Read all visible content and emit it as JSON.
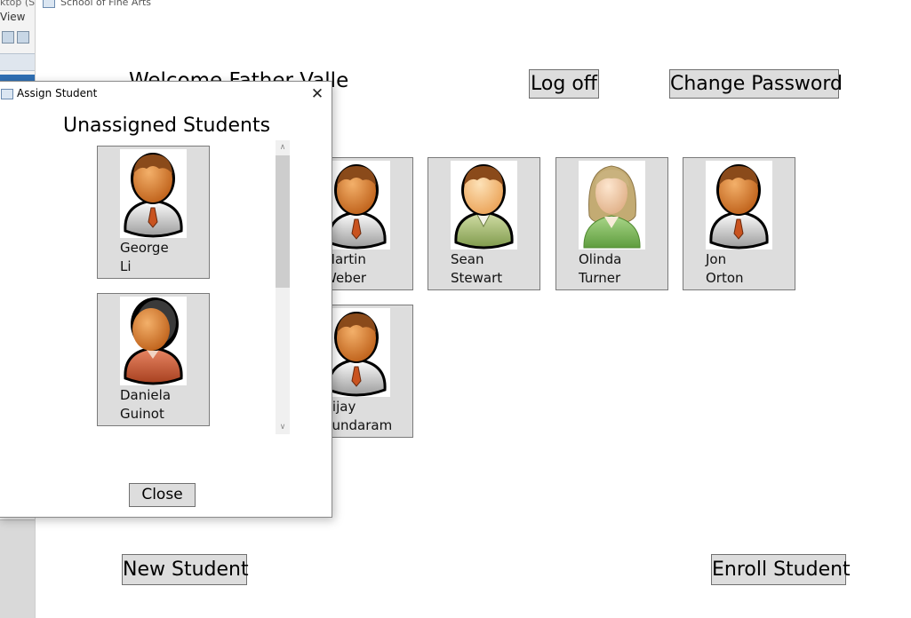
{
  "background_ide": {
    "title": "ktop (S",
    "menu": "View"
  },
  "main": {
    "title": "School of Fine Arts",
    "welcome": "Welcome Father Valle",
    "logoff_label": "Log off",
    "change_password_label": "Change Password",
    "new_student_label": "New Student",
    "enroll_student_label": "Enroll Student",
    "students": [
      {
        "first": "Martin",
        "last": "Weber",
        "avatar": "male-student-orange-tie"
      },
      {
        "first": "Sean",
        "last": "Stewart",
        "avatar": "male-student-green-shirt"
      },
      {
        "first": "Olinda",
        "last": "Turner",
        "avatar": "female-student-green-shirt"
      },
      {
        "first": "Jon",
        "last": "Orton",
        "avatar": "male-student-orange-tie"
      },
      {
        "first": "Vijay",
        "last": "Sundaram",
        "avatar": "male-student-orange-tie"
      }
    ]
  },
  "dialog": {
    "title": "Assign Student",
    "heading": "Unassigned Students",
    "close_label": "Close",
    "students": [
      {
        "first": "George",
        "last": "Li",
        "avatar": "male-student-orange-tie"
      },
      {
        "first": "Daniela",
        "last": "Guinot",
        "avatar": "female-student-red-shirt"
      }
    ],
    "scroll_up_glyph": "∧",
    "scroll_down_glyph": "∨",
    "close_glyph": "✕"
  },
  "colors": {
    "button_face": "#dddddd",
    "button_border": "#707070",
    "skin": "#d98a3c",
    "hair_brown": "#8a4a1a",
    "tie": "#c9531f"
  }
}
